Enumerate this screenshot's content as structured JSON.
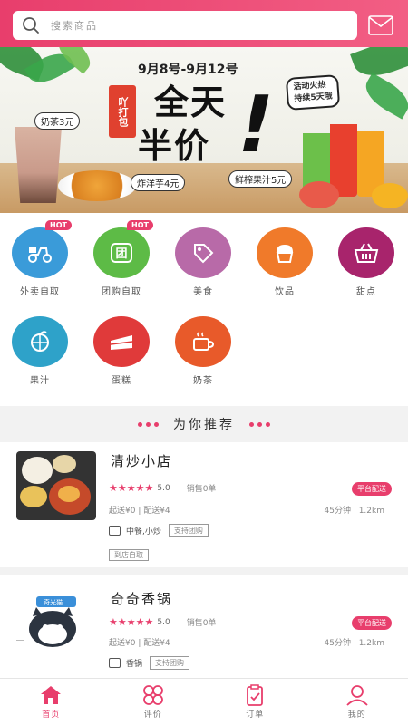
{
  "header": {
    "search_placeholder": "搜索商品"
  },
  "banner": {
    "date_range": "9月8号-9月12号",
    "headline_line1": "全天",
    "headline_line2": "半价",
    "headline_mark": "!",
    "brand_tag": "吖打包",
    "promo_badge_line1": "活动火热",
    "promo_badge_line2": "持续5天哦",
    "tea_label": "奶茶3元",
    "potato_label": "炸洋芋4元",
    "juice_label": "鲜榨果汁5元"
  },
  "categories": [
    {
      "label": "外卖自取",
      "hot": "HOT",
      "color": "#3a9bd9",
      "icon": "scooter-icon"
    },
    {
      "label": "团购自取",
      "hot": "HOT",
      "color": "#5dbb46",
      "icon": "group-buy-icon"
    },
    {
      "label": "美食",
      "hot": "",
      "color": "#b86aa8",
      "icon": "tag-icon"
    },
    {
      "label": "饮品",
      "hot": "",
      "color": "#f07a2a",
      "icon": "cupcake-icon"
    },
    {
      "label": "甜点",
      "hot": "",
      "color": "#a8246c",
      "icon": "basket-icon"
    },
    {
      "label": "果汁",
      "hot": "",
      "color": "#2ea2c9",
      "icon": "orange-icon"
    },
    {
      "label": "蛋糕",
      "hot": "",
      "color": "#e03a3a",
      "icon": "cake-icon"
    },
    {
      "label": "奶茶",
      "hot": "",
      "color": "#e85a2a",
      "icon": "tea-cup-icon"
    }
  ],
  "recommend": {
    "title": "为你推荐"
  },
  "shops": [
    {
      "name": "清炒小店",
      "rating": "5.0",
      "sales": "销售0单",
      "delivery_tag": "平台配送",
      "fee": "起送¥0 | 配送¥4",
      "time": "45分钟 | 1.2km",
      "category": "中餐,小炒",
      "support_tag": "支持团购",
      "extra_tag": "到店自取"
    },
    {
      "name": "奇奇香锅",
      "rating": "5.0",
      "sales": "销售0单",
      "delivery_tag": "平台配送",
      "fee": "起送¥0 | 配送¥4",
      "time": "45分钟 | 1.2km",
      "category": "香锅",
      "support_tag": "支持团购",
      "logo_text": "奇光猫..."
    }
  ],
  "tabbar": [
    {
      "label": "首页",
      "icon": "home-icon",
      "active": true
    },
    {
      "label": "评价",
      "icon": "grid-icon",
      "active": false
    },
    {
      "label": "订单",
      "icon": "order-icon",
      "active": false
    },
    {
      "label": "我的",
      "icon": "user-icon",
      "active": false
    }
  ],
  "colors": {
    "accent": "#e83e6c",
    "header_gradient_end": "#f25e84"
  }
}
